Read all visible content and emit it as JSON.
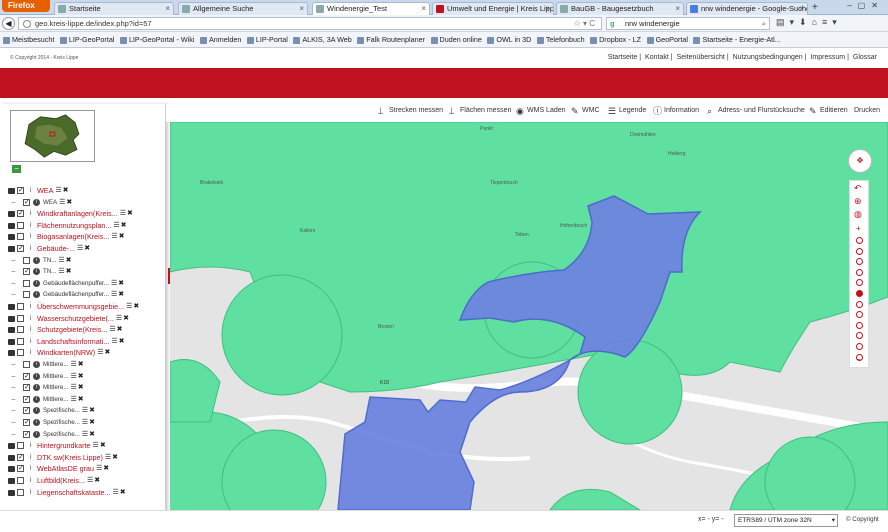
{
  "browser": {
    "menu_button": "Firefox",
    "tabs": [
      {
        "label": "Startseite",
        "active": false
      },
      {
        "label": "Allgemeine Suche",
        "active": false
      },
      {
        "label": "Windenergie_Test",
        "active": true
      },
      {
        "label": "Umwelt und Energie | Kreis Lippe",
        "active": false
      },
      {
        "label": "BauGB - Baugesetzbuch",
        "active": false
      },
      {
        "label": "nrw windenergie - Google-Suche",
        "active": false
      }
    ],
    "new_tab": "+",
    "url": "geo.kreis-lippe.de/index.php?id=57",
    "search_value": "nrw windenergie",
    "bookmarks": [
      "Meistbesucht",
      "LIP-GeoPortal",
      "LIP-GeoPortal - Wiki",
      "Anmelden",
      "LIP-Portal",
      "ALKIS, 3A Web",
      "Falk Routenplaner",
      "Duden online",
      "OWL in 3D",
      "Telefonbuch",
      "Dropbox - LZ",
      "GeoPortal",
      "Startseite - Energie-Atl..."
    ]
  },
  "page": {
    "copyright_top": "© Copyright 2014 - Kreis Lippe",
    "top_links": [
      "Startseite",
      "Kontakt",
      "Seitenübersicht",
      "Nutzungsbedingungen",
      "Impressum",
      "Glossar"
    ],
    "top_link_separator": "|",
    "sidebar_toggle": "−",
    "overview_collapse": "−"
  },
  "toolbar": {
    "items": [
      {
        "label": "Strecken messen",
        "icon": "ruler-icon"
      },
      {
        "label": "Flächen messen",
        "icon": "area-measure-icon"
      },
      {
        "label": "WMS Laden",
        "icon": "globe-icon"
      },
      {
        "label": "WMC",
        "icon": "edit-icon"
      },
      {
        "label": "Legende",
        "icon": "list-icon"
      },
      {
        "label": "Information",
        "icon": "info-icon"
      },
      {
        "label": "Adress- und Flurstücksuche",
        "icon": "search-icon"
      },
      {
        "label": "Editieren",
        "icon": "pencil-icon"
      },
      {
        "label": "Drucken",
        "icon": ""
      }
    ]
  },
  "layers": [
    {
      "label": "WEA",
      "level": 0,
      "checked": true,
      "main": true
    },
    {
      "label": "WEA",
      "level": 1,
      "checked": true,
      "main": false
    },
    {
      "label": "Windkraftanlagen(Kreis...",
      "level": 0,
      "checked": true,
      "main": true
    },
    {
      "label": "Flächennutzungsplan...",
      "level": 0,
      "checked": false,
      "main": true
    },
    {
      "label": "Biogasanlagen(Kreis...",
      "level": 0,
      "checked": false,
      "main": true
    },
    {
      "label": "Gebäude-...",
      "level": 0,
      "checked": true,
      "main": true
    },
    {
      "label": "TN...",
      "level": 1,
      "checked": false,
      "main": false
    },
    {
      "label": "TN...",
      "level": 1,
      "checked": true,
      "main": false
    },
    {
      "label": "Gebäudeflächenpuffer...",
      "level": 1,
      "checked": false,
      "main": false
    },
    {
      "label": "Gebäudeflächenpuffer...",
      "level": 1,
      "checked": false,
      "main": false
    },
    {
      "label": "Überschwemmungsgebie...",
      "level": 0,
      "checked": false,
      "main": true
    },
    {
      "label": "Wasserschutzgebiete(...",
      "level": 0,
      "checked": false,
      "main": true
    },
    {
      "label": "Schutzgebiete(Kreis...",
      "level": 0,
      "checked": false,
      "main": true
    },
    {
      "label": "Landschaftsinformati...",
      "level": 0,
      "checked": false,
      "main": true
    },
    {
      "label": "Windkarten(NRW)",
      "level": 0,
      "checked": false,
      "main": true
    },
    {
      "label": "Mittlere...",
      "level": 1,
      "checked": false,
      "main": false
    },
    {
      "label": "Mittlere...",
      "level": 1,
      "checked": true,
      "main": false
    },
    {
      "label": "Mittlere...",
      "level": 1,
      "checked": true,
      "main": false
    },
    {
      "label": "Mittlere...",
      "level": 1,
      "checked": true,
      "main": false
    },
    {
      "label": "Spezifische...",
      "level": 1,
      "checked": true,
      "main": false
    },
    {
      "label": "Spezifische...",
      "level": 1,
      "checked": true,
      "main": false
    },
    {
      "label": "Spezifische...",
      "level": 1,
      "checked": true,
      "main": false
    },
    {
      "label": "Hintergrundkarte",
      "level": 0,
      "checked": false,
      "main": true
    },
    {
      "label": "DTK sw(Kreis Lippe)",
      "level": 0,
      "checked": true,
      "main": true
    },
    {
      "label": "WebAtlasDE grau",
      "level": 0,
      "checked": true,
      "main": true
    },
    {
      "label": "Luftbild(Kreis...",
      "level": 0,
      "checked": false,
      "main": true
    },
    {
      "label": "Liegenschaftskataste...",
      "level": 0,
      "checked": false,
      "main": true
    }
  ],
  "map": {
    "place_labels": [
      "Pankt",
      "Heiberg",
      "Tiepenbruch",
      "Hohenbruch",
      "Teben",
      "Brosen",
      "Kallers",
      "Dreimühlen",
      "Brakelsiek"
    ],
    "road_label": "K18",
    "colors": {
      "green": "#5fe0a0",
      "blue": "#6d85e0",
      "background": "#e4e4e4",
      "road": "#ffffff",
      "accent": "#c0111f"
    }
  },
  "zoom": {
    "nav_icon": "pan-arrows-icon",
    "levels": 12,
    "current": 5,
    "zoom_in": "+",
    "zoom_out": "−"
  },
  "status": {
    "coords": "x= - y= -",
    "projection": "ETRS89 / UTM zone 32N",
    "copyright": "© Copyright"
  }
}
